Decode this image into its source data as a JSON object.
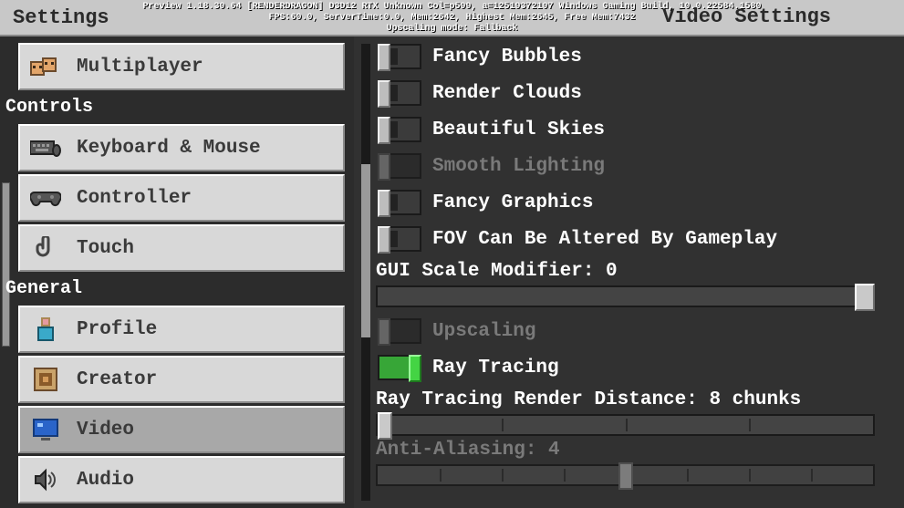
{
  "debug": {
    "line1": "Preview 1.18.30.64 [RENDERDRAGON] D3D12 RTX Unknown Col=p599, a=12519372107 Windows Gaming Build, 10.0.22584.1580",
    "line2": "FPS:60.0, ServerTime:0.0, Mem:2642, Highest Mem:2645, Free Mem:7432",
    "line3": "Upscaling mode: Fallback"
  },
  "header": {
    "title": "Settings",
    "rightTitle": "Video Settings"
  },
  "sidebar": {
    "multiplayer": "Multiplayer",
    "section_controls": "Controls",
    "keyboard": "Keyboard & Mouse",
    "controller": "Controller",
    "touch": "Touch",
    "section_general": "General",
    "profile": "Profile",
    "creator": "Creator",
    "video": "Video",
    "audio": "Audio"
  },
  "video": {
    "fancy_bubbles": "Fancy Bubbles",
    "render_clouds": "Render Clouds",
    "beautiful_skies": "Beautiful Skies",
    "smooth_lighting": "Smooth Lighting",
    "fancy_graphics": "Fancy Graphics",
    "fov_gameplay": "FOV Can Be Altered By Gameplay",
    "gui_scale_label": "GUI Scale Modifier: 0",
    "upscaling": "Upscaling",
    "ray_tracing": "Ray Tracing",
    "rt_distance_label": "Ray Tracing Render Distance: 8 chunks",
    "aa_label": "Anti-Aliasing: 4"
  }
}
